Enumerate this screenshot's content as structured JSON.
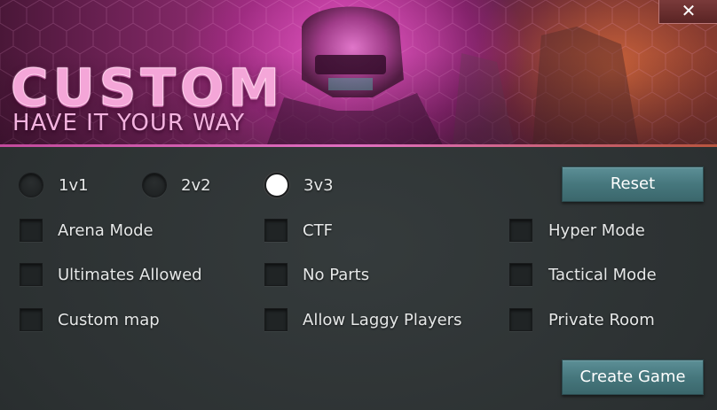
{
  "banner": {
    "title": "CUSTOM",
    "subtitle": "HAVE IT YOUR WAY",
    "close_glyph": "✕"
  },
  "modes": [
    {
      "label": "1v1",
      "selected": false
    },
    {
      "label": "2v2",
      "selected": false
    },
    {
      "label": "3v3",
      "selected": true
    }
  ],
  "options": [
    {
      "label": "Arena Mode",
      "checked": false
    },
    {
      "label": "CTF",
      "checked": false
    },
    {
      "label": "Hyper Mode",
      "checked": false
    },
    {
      "label": "Ultimates Allowed",
      "checked": false
    },
    {
      "label": "No Parts",
      "checked": false
    },
    {
      "label": "Tactical Mode",
      "checked": false
    },
    {
      "label": "Custom map",
      "checked": false
    },
    {
      "label": "Allow Laggy Players",
      "checked": false
    },
    {
      "label": "Private Room",
      "checked": false
    }
  ],
  "buttons": {
    "reset": "Reset",
    "create": "Create Game"
  },
  "colors": {
    "accent_button": "#4b7d83",
    "title_pink": "#f4a6d8",
    "panel_bg": "#2e3334"
  }
}
